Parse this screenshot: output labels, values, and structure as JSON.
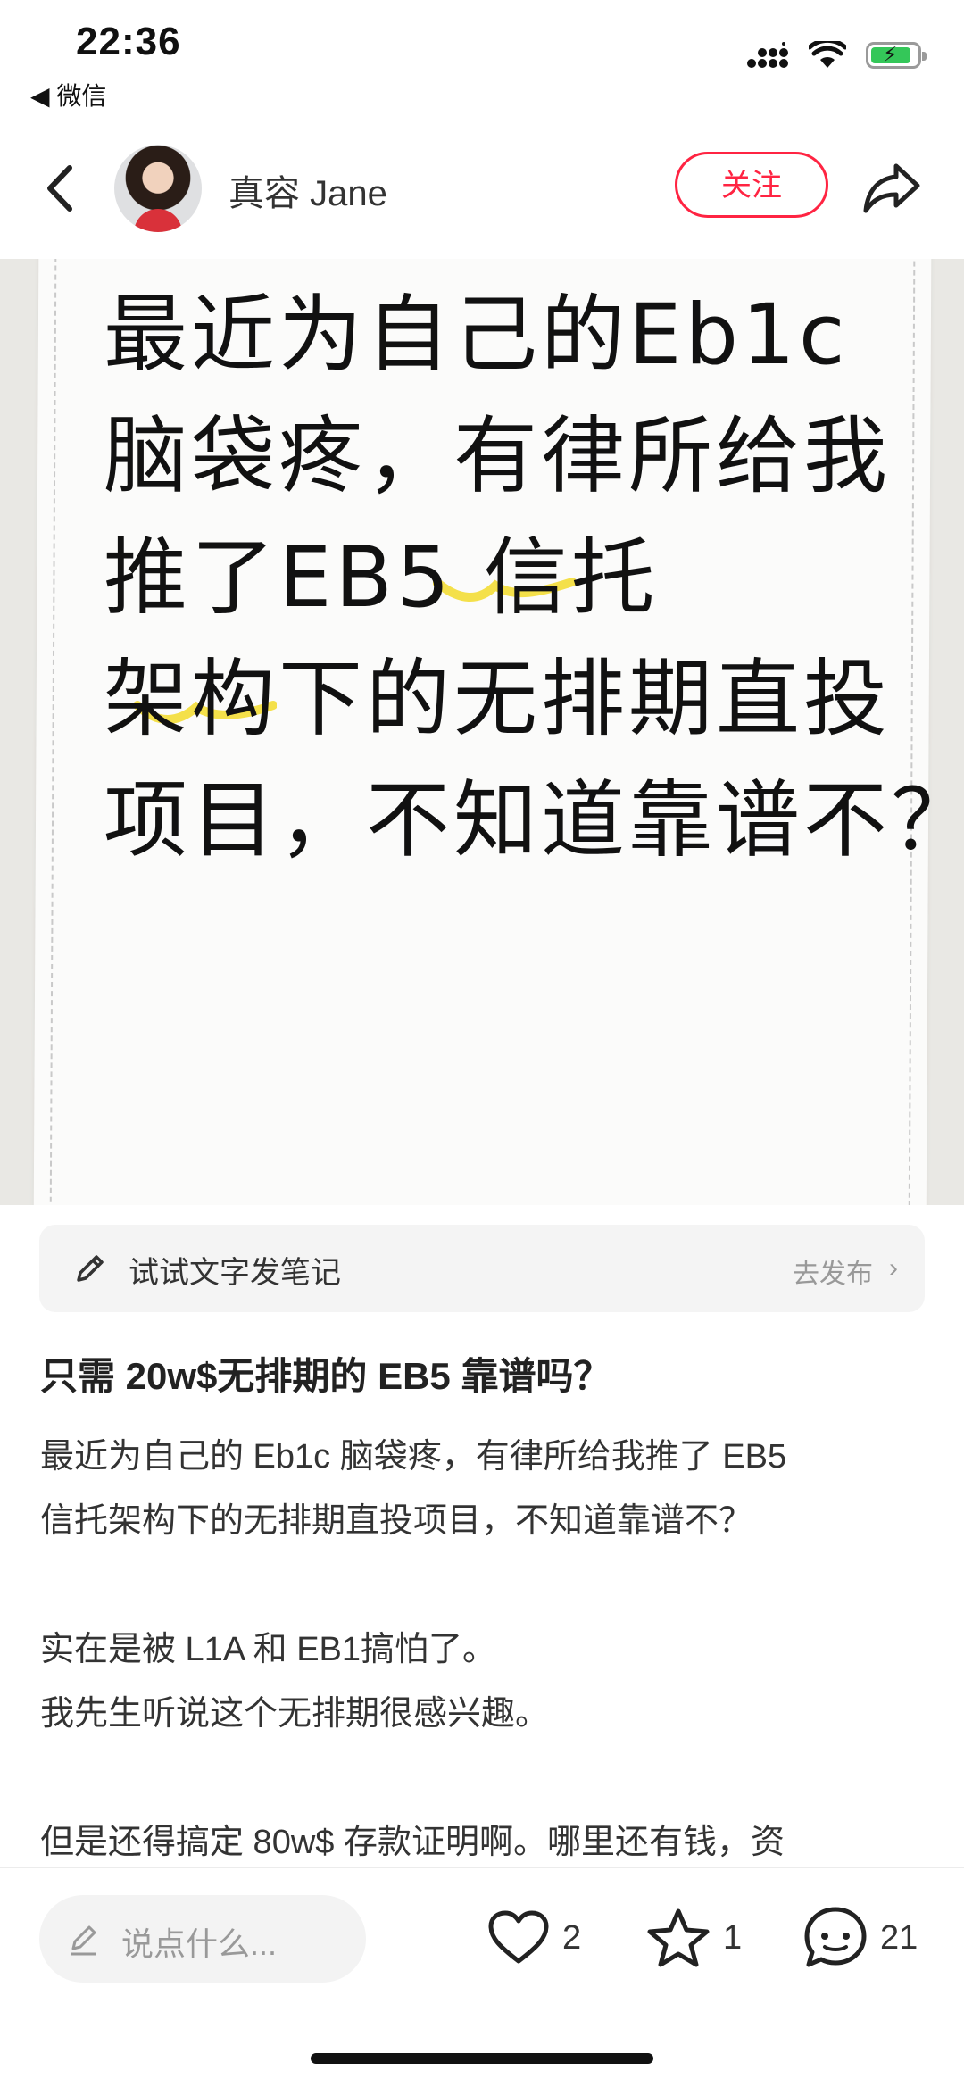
{
  "status_bar": {
    "time": "22:36",
    "back_app": "◀ 微信"
  },
  "header": {
    "author_name": "真容 Jane",
    "follow_label": "关注"
  },
  "image_text": {
    "lines": [
      "最近为自己的Eb1c",
      "脑袋疼，有律所给我",
      "推了EB5 信托",
      "架构下的无排期直投",
      "项目，不知道靠谱不？"
    ]
  },
  "note_bar": {
    "label": "试试文字发笔记",
    "publish_label": "去发布"
  },
  "post": {
    "title": "只需 20w$无排期的 EB5 靠谱吗？",
    "body": [
      "最近为自己的 Eb1c 脑袋疼，有律所给我推了 EB5",
      "信托架构下的无排期直投项目，不知道靠谱不？",
      "",
      "实在是被 L1A 和 EB1搞怕了。",
      "我先生听说这个无排期很感兴趣。",
      "",
      "但是还得搞定 80w$ 存款证明啊。哪里还有钱，资"
    ]
  },
  "bottom_bar": {
    "comment_placeholder": "说点什么...",
    "like_count": "2",
    "collect_count": "1",
    "comment_count": "21"
  },
  "colors": {
    "accent": "#ff2442",
    "highlight": "#f4e04a"
  }
}
